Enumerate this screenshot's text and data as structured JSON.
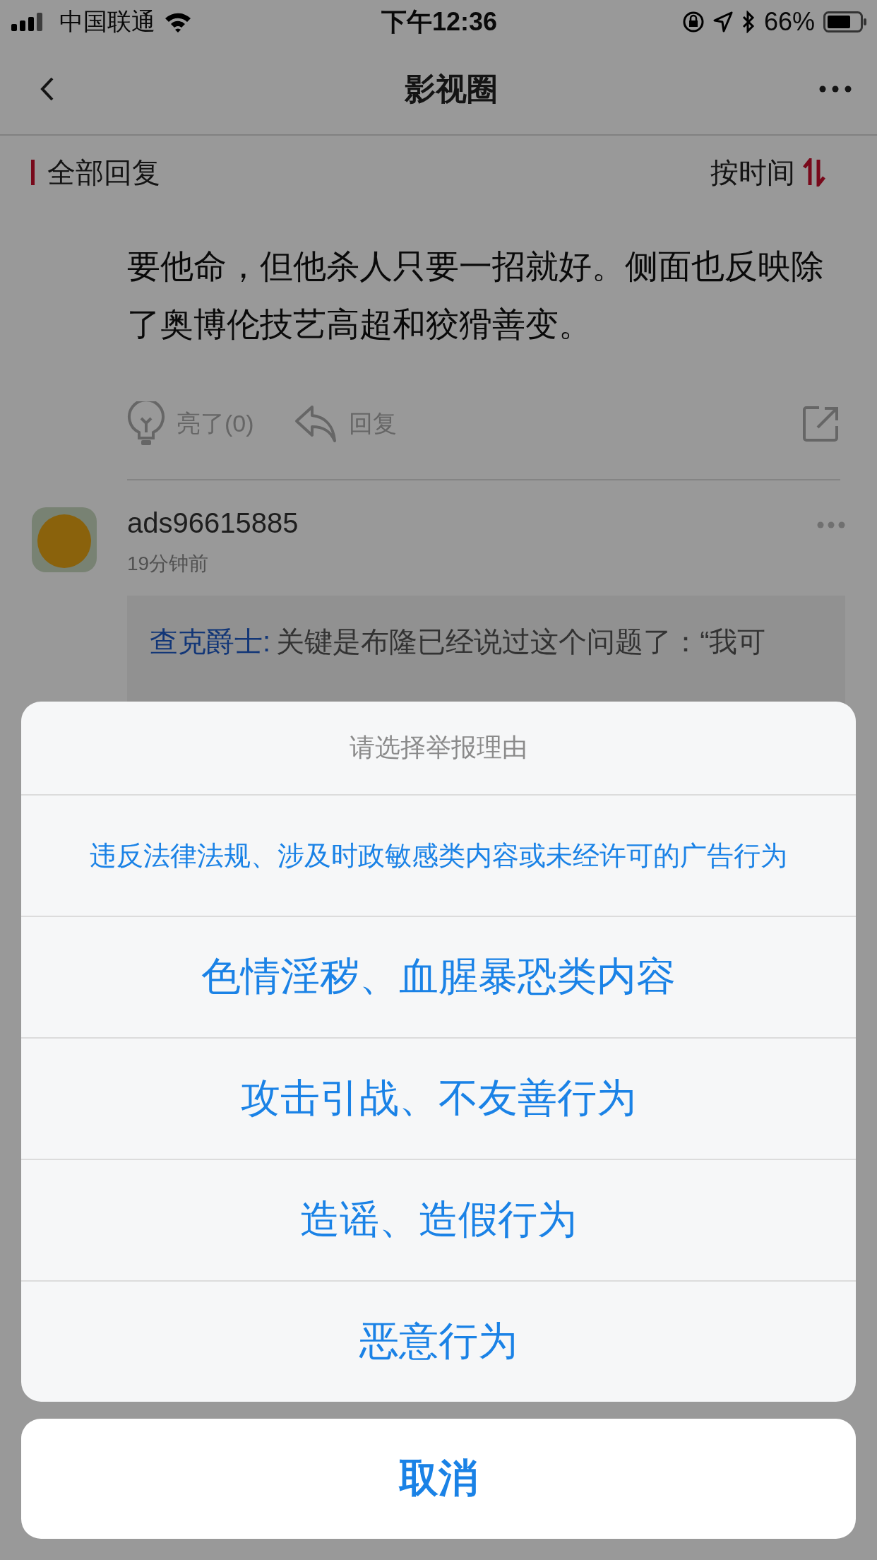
{
  "status_bar": {
    "carrier": "中国联通",
    "time": "下午12:36",
    "battery": "66%"
  },
  "nav": {
    "title": "影视圈"
  },
  "section": {
    "title": "全部回复",
    "sort": "按时间"
  },
  "comment": {
    "lines": [
      "要他命，但他杀人只要一招就好。侧面也反映除",
      "了奥博伦技艺高超和狡猾善变。"
    ],
    "like": "亮了(0)",
    "reply": "回复"
  },
  "reply": {
    "user": "ads96615885",
    "time": "19分钟前",
    "quote_author": "查克爵士:",
    "quote_text": "关键是布隆已经说过这个问题了：“我可"
  },
  "sheet": {
    "title": "请选择举报理由",
    "options": [
      {
        "label": "违反法律法规、涉及时政敏感类内容或未经许可的广告行为",
        "kind": "small"
      },
      {
        "label": "色情淫秽、血腥暴恐类内容",
        "kind": "large"
      },
      {
        "label": "攻击引战、不友善行为",
        "kind": "large"
      },
      {
        "label": "造谣、造假行为",
        "kind": "large"
      },
      {
        "label": "恶意行为",
        "kind": "large"
      }
    ],
    "cancel": "取消"
  }
}
